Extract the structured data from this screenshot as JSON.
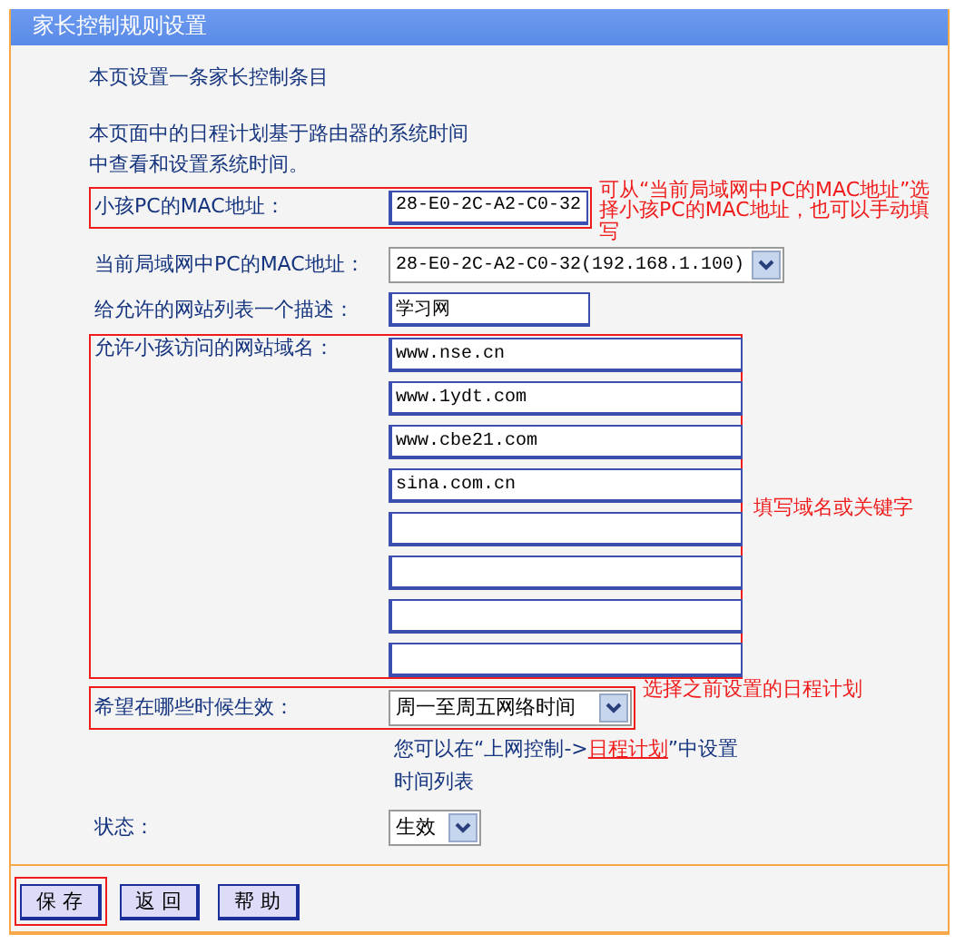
{
  "title": "家长控制规则设置",
  "intro": "本页设置一条家长控制条目",
  "notice_lines": [
    "本页面中的日程计划基于路由器的系统时间",
    "中查看和设置系统时间。"
  ],
  "child_mac": {
    "label": "小孩PC的MAC地址：",
    "value": "28-E0-2C-A2-C0-32",
    "highlighted": true,
    "callout": "可从“当前局域网中PC的MAC地址”选择小孩PC的MAC地址，也可以手动填写"
  },
  "lan_mac": {
    "label": "当前局域网中PC的MAC地址：",
    "value": "28-E0-2C-A2-C0-32(192.168.1.100)"
  },
  "description": {
    "label": "给允许的网站列表一个描述：",
    "value": "学习网"
  },
  "domains": {
    "label": "允许小孩访问的网站域名：",
    "highlighted": true,
    "callout": "填写域名或关键字",
    "fields": [
      {
        "kind": "filled",
        "value": "www.nse.cn"
      },
      {
        "kind": "filled",
        "value": "www.1ydt.com"
      },
      {
        "kind": "filled",
        "value": "www.cbe21.com"
      },
      {
        "kind": "filled",
        "value": "sina.com.cn"
      },
      {
        "kind": "blank"
      },
      {
        "kind": "blank"
      },
      {
        "kind": "blank"
      },
      {
        "kind": "blank"
      }
    ]
  },
  "schedule": {
    "label": "希望在哪些时候生效：",
    "value": "周一至周五网络时间",
    "highlighted": true,
    "callout": "选择之前设置的日程计划"
  },
  "schedule_note": {
    "before": "您可以在“上网控制->",
    "link": "日程计划",
    "after": "”中设置时间列表"
  },
  "status": {
    "label": "状态：",
    "value": "生效"
  },
  "buttons": [
    {
      "label": "保 存",
      "highlighted": true
    },
    {
      "label": "返 回",
      "highlighted": false
    },
    {
      "label": "帮 助",
      "highlighted": false
    }
  ]
}
